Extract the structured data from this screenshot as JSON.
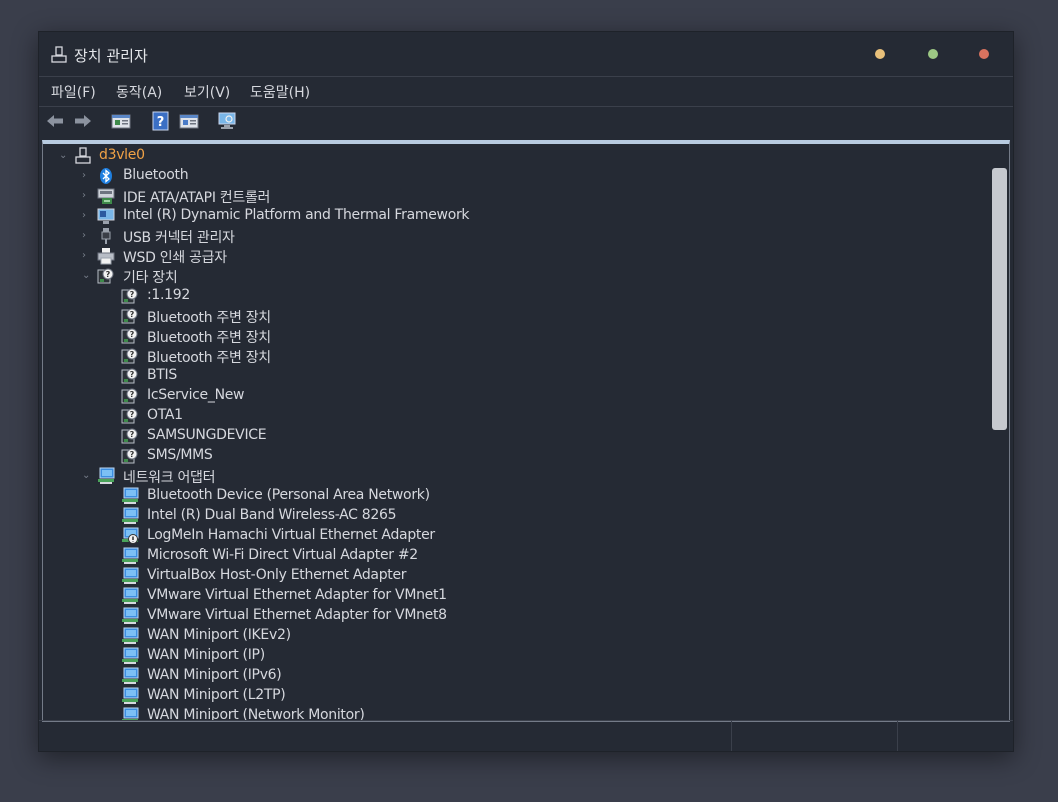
{
  "window": {
    "title": "장치 관리자"
  },
  "menu": [
    {
      "label": "파일(F)"
    },
    {
      "label": "동작(A)"
    },
    {
      "label": "보기(V)"
    },
    {
      "label": "도움말(H)"
    }
  ],
  "toolbar": [
    {
      "icon": "back-arrow-icon"
    },
    {
      "icon": "forward-arrow-icon"
    },
    {
      "icon": "properties-icon"
    },
    {
      "icon": "help-icon"
    },
    {
      "icon": "update-driver-icon"
    },
    {
      "icon": "scan-hardware-icon"
    }
  ],
  "tree": [
    {
      "label": "d3vle0",
      "level": 0,
      "expanded": true,
      "icon": "computer-icon",
      "root": true
    },
    {
      "label": "Bluetooth",
      "level": 1,
      "expanded": false,
      "icon": "bluetooth-icon"
    },
    {
      "label": "IDE ATA/ATAPI 컨트롤러",
      "level": 1,
      "expanded": false,
      "icon": "ide-controller-icon"
    },
    {
      "label": "Intel (R) Dynamic Platform and Thermal Framework",
      "level": 1,
      "expanded": false,
      "icon": "system-device-icon"
    },
    {
      "label": "USB 커넥터 관리자",
      "level": 1,
      "expanded": false,
      "icon": "usb-connector-icon"
    },
    {
      "label": "WSD 인쇄 공급자",
      "level": 1,
      "expanded": false,
      "icon": "printer-icon"
    },
    {
      "label": "기타 장치",
      "level": 1,
      "expanded": true,
      "icon": "unknown-device-icon"
    },
    {
      "label": ":1.192",
      "level": 2,
      "icon": "unknown-device-icon"
    },
    {
      "label": "Bluetooth 주변 장치",
      "level": 2,
      "icon": "unknown-device-icon"
    },
    {
      "label": "Bluetooth 주변 장치",
      "level": 2,
      "icon": "unknown-device-icon"
    },
    {
      "label": "Bluetooth 주변 장치",
      "level": 2,
      "icon": "unknown-device-icon"
    },
    {
      "label": "BTIS",
      "level": 2,
      "icon": "unknown-device-icon"
    },
    {
      "label": "IcService_New",
      "level": 2,
      "icon": "unknown-device-icon"
    },
    {
      "label": "OTA1",
      "level": 2,
      "icon": "unknown-device-icon"
    },
    {
      "label": "SAMSUNGDEVICE",
      "level": 2,
      "icon": "unknown-device-icon"
    },
    {
      "label": "SMS/MMS",
      "level": 2,
      "icon": "unknown-device-icon"
    },
    {
      "label": "네트워크 어댑터",
      "level": 1,
      "expanded": true,
      "icon": "network-adapter-icon"
    },
    {
      "label": "Bluetooth Device (Personal Area Network)",
      "level": 2,
      "icon": "network-adapter-icon"
    },
    {
      "label": "Intel (R) Dual Band Wireless-AC 8265",
      "level": 2,
      "icon": "network-adapter-icon"
    },
    {
      "label": "LogMeIn Hamachi Virtual Ethernet Adapter",
      "level": 2,
      "icon": "network-adapter-disabled-icon"
    },
    {
      "label": "Microsoft Wi-Fi Direct Virtual Adapter #2",
      "level": 2,
      "icon": "network-adapter-icon"
    },
    {
      "label": "VirtualBox Host-Only Ethernet Adapter",
      "level": 2,
      "icon": "network-adapter-icon"
    },
    {
      "label": "VMware Virtual Ethernet Adapter for VMnet1",
      "level": 2,
      "icon": "network-adapter-icon"
    },
    {
      "label": "VMware Virtual Ethernet Adapter for VMnet8",
      "level": 2,
      "icon": "network-adapter-icon"
    },
    {
      "label": "WAN Miniport (IKEv2)",
      "level": 2,
      "icon": "network-adapter-icon"
    },
    {
      "label": "WAN Miniport (IP)",
      "level": 2,
      "icon": "network-adapter-icon"
    },
    {
      "label": "WAN Miniport (IPv6)",
      "level": 2,
      "icon": "network-adapter-icon"
    },
    {
      "label": "WAN Miniport (L2TP)",
      "level": 2,
      "icon": "network-adapter-icon"
    },
    {
      "label": "WAN Miniport (Network Monitor)",
      "level": 2,
      "icon": "network-adapter-icon"
    }
  ],
  "colors": {
    "background": "#3a3e4b",
    "window": "#252a34",
    "root_label": "#f0a246",
    "text": "#d6d8de",
    "tree_top_border": "#b8cbe0",
    "scroll_thumb": "#c6c9cf"
  }
}
